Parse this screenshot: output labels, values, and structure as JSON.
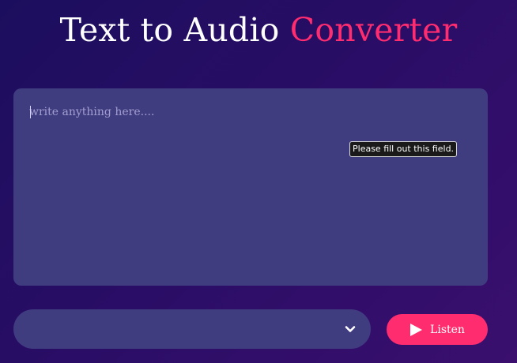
{
  "header": {
    "title_main": "Text to Audio",
    "title_accent": "Converter"
  },
  "editor": {
    "placeholder": "write anything here....",
    "value": "",
    "validation_tooltip": "Please fill out this field."
  },
  "voice_select": {
    "selected": "",
    "icon": "chevron-down-icon"
  },
  "listen_button": {
    "label": "Listen",
    "icon": "play-icon"
  },
  "colors": {
    "accent": "#ff2d6f",
    "panel": "#403c80",
    "background": "#1c0e5e"
  }
}
